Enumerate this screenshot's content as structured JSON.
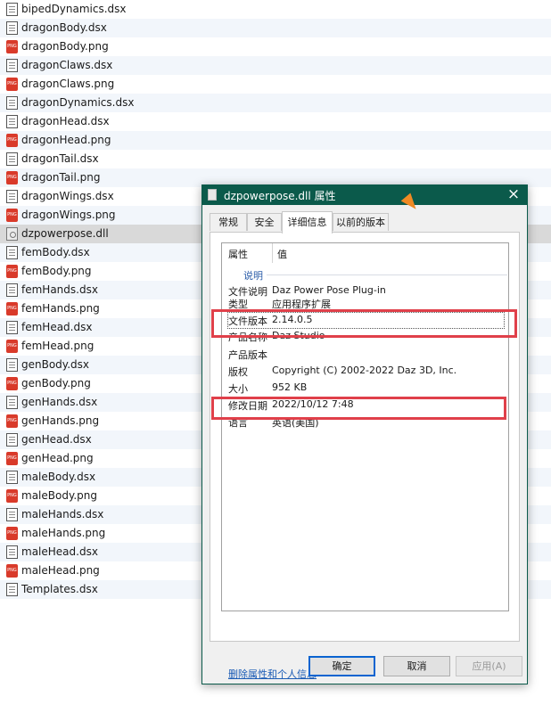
{
  "files": [
    {
      "name": "bipedDynamics.dsx",
      "type": "doc"
    },
    {
      "name": "dragonBody.dsx",
      "type": "doc"
    },
    {
      "name": "dragonBody.png",
      "type": "png"
    },
    {
      "name": "dragonClaws.dsx",
      "type": "doc"
    },
    {
      "name": "dragonClaws.png",
      "type": "png"
    },
    {
      "name": "dragonDynamics.dsx",
      "type": "doc"
    },
    {
      "name": "dragonHead.dsx",
      "type": "doc"
    },
    {
      "name": "dragonHead.png",
      "type": "png"
    },
    {
      "name": "dragonTail.dsx",
      "type": "doc"
    },
    {
      "name": "dragonTail.png",
      "type": "png"
    },
    {
      "name": "dragonWings.dsx",
      "type": "doc"
    },
    {
      "name": "dragonWings.png",
      "type": "png"
    },
    {
      "name": "dzpowerpose.dll",
      "type": "dll",
      "selected": true
    },
    {
      "name": "femBody.dsx",
      "type": "doc"
    },
    {
      "name": "femBody.png",
      "type": "png"
    },
    {
      "name": "femHands.dsx",
      "type": "doc"
    },
    {
      "name": "femHands.png",
      "type": "png"
    },
    {
      "name": "femHead.dsx",
      "type": "doc"
    },
    {
      "name": "femHead.png",
      "type": "png"
    },
    {
      "name": "genBody.dsx",
      "type": "doc"
    },
    {
      "name": "genBody.png",
      "type": "png"
    },
    {
      "name": "genHands.dsx",
      "type": "doc"
    },
    {
      "name": "genHands.png",
      "type": "png"
    },
    {
      "name": "genHead.dsx",
      "type": "doc"
    },
    {
      "name": "genHead.png",
      "type": "png"
    },
    {
      "name": "maleBody.dsx",
      "type": "doc"
    },
    {
      "name": "maleBody.png",
      "type": "png"
    },
    {
      "name": "maleHands.dsx",
      "type": "doc"
    },
    {
      "name": "maleHands.png",
      "type": "png"
    },
    {
      "name": "maleHead.dsx",
      "type": "doc"
    },
    {
      "name": "maleHead.png",
      "type": "png"
    },
    {
      "name": "Templates.dsx",
      "type": "doc"
    }
  ],
  "dialog": {
    "title": "dzpowerpose.dll 属性",
    "close_icon": "close-icon",
    "title_bar_color": "#0b5a4b",
    "tabs": [
      {
        "label": "常规",
        "active": false
      },
      {
        "label": "安全",
        "active": false
      },
      {
        "label": "详细信息",
        "active": true
      },
      {
        "label": "以前的版本",
        "active": false
      }
    ],
    "columns": {
      "property": "属性",
      "value": "值"
    },
    "group": "说明",
    "properties": [
      {
        "name": "文件说明",
        "value": "Daz Power Pose Plug-in"
      },
      {
        "name": "类型",
        "value": "应用程序扩展"
      },
      {
        "name": "文件版本",
        "value": "2.14.0.5",
        "focused": true
      },
      {
        "name": "产品名称",
        "value": "Daz Studio"
      },
      {
        "name": "产品版本",
        "value": ""
      },
      {
        "name": "版权",
        "value": "Copyright (C) 2002-2022 Daz 3D, Inc."
      },
      {
        "name": "大小",
        "value": "952 KB"
      },
      {
        "name": "修改日期",
        "value": "2022/10/12 7:48"
      },
      {
        "name": "语言",
        "value": "英语(美国)"
      }
    ],
    "remove_link": "删除属性和个人信息",
    "buttons": {
      "ok": "确定",
      "cancel": "取消",
      "apply": "应用(A)"
    },
    "highlight_color": "#e0404a"
  }
}
